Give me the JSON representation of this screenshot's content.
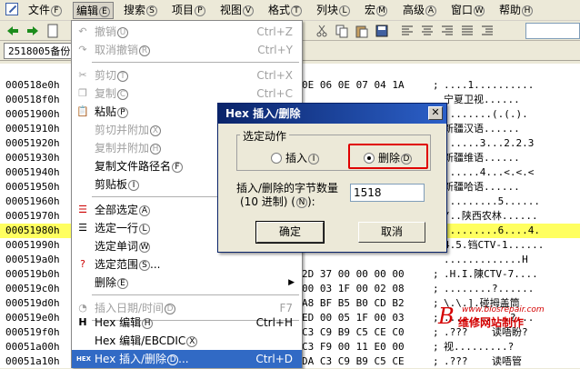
{
  "menubar": {
    "items": [
      {
        "label": "文件",
        "key": "F"
      },
      {
        "label": "编辑",
        "key": "E"
      },
      {
        "label": "搜索",
        "key": "S"
      },
      {
        "label": "项目",
        "key": "P"
      },
      {
        "label": "视图",
        "key": "V"
      },
      {
        "label": "格式",
        "key": "T"
      },
      {
        "label": "列块",
        "key": "L"
      },
      {
        "label": "宏",
        "key": "M"
      },
      {
        "label": "高级",
        "key": "A"
      },
      {
        "label": "窗口",
        "key": "W"
      },
      {
        "label": "帮助",
        "key": "H"
      }
    ]
  },
  "tab": {
    "label": "2518005备份"
  },
  "dropdown": {
    "items": [
      {
        "label": "撤销",
        "key": "U",
        "shortcut": "Ctrl+Z",
        "disabled": true,
        "icon": "undo-icon"
      },
      {
        "label": "取消撤销",
        "key": "R",
        "shortcut": "Ctrl+Y",
        "disabled": true,
        "icon": "redo-icon"
      },
      {
        "label": "剪切",
        "key": "T",
        "shortcut": "Ctrl+X",
        "disabled": true,
        "icon": "cut-icon"
      },
      {
        "label": "复制",
        "key": "C",
        "shortcut": "Ctrl+C",
        "disabled": true,
        "icon": "copy-icon"
      },
      {
        "label": "粘贴",
        "key": "P",
        "shortcut": "",
        "disabled": false,
        "icon": "paste-icon"
      },
      {
        "label": "剪切并附加",
        "key": "X",
        "shortcut": "",
        "disabled": true,
        "icon": ""
      },
      {
        "label": "复制并附加",
        "key": "H",
        "shortcut": "",
        "disabled": true,
        "icon": ""
      },
      {
        "label": "复制文件路径名",
        "key": "F",
        "shortcut": "",
        "disabled": false,
        "icon": ""
      },
      {
        "label": "剪贴板",
        "key": "I",
        "shortcut": "",
        "disabled": false,
        "icon": "",
        "submenu": true
      },
      {
        "label": "全部选定",
        "key": "A",
        "shortcut": "",
        "disabled": false,
        "icon": "select-all-icon"
      },
      {
        "label": "选定一行",
        "key": "L",
        "shortcut": "",
        "disabled": false,
        "icon": "select-line-icon"
      },
      {
        "label": "选定单词",
        "key": "W",
        "shortcut": "",
        "disabled": false,
        "icon": ""
      },
      {
        "label": "选定范围",
        "key": "S",
        "shortcut": "",
        "disabled": false,
        "icon": "select-range-icon",
        "suffix": "..."
      },
      {
        "label": "删除",
        "key": "E",
        "shortcut": "",
        "disabled": false,
        "icon": "",
        "submenu": true
      },
      {
        "label": "插入日期/时间",
        "key": "D",
        "shortcut": "F7",
        "disabled": true,
        "icon": "clock-icon"
      },
      {
        "label": "Hex 编辑",
        "key": "H",
        "shortcut": "Ctrl+H",
        "disabled": false,
        "icon": "hex-icon"
      },
      {
        "label": "Hex 编辑/EBCDIC",
        "key": "X",
        "shortcut": "",
        "disabled": false,
        "icon": ""
      },
      {
        "label": "Hex 插入/删除",
        "key": "D",
        "shortcut": "Ctrl+D",
        "disabled": false,
        "icon": "hex-insert-icon",
        "suffix": "...",
        "selected": true
      }
    ]
  },
  "hex_rows": [
    {
      "addr": "000518e0h",
      "hex": "0E 06 0E 07 04 1A",
      "ascii": "....1.........."
    },
    {
      "addr": "000518f0h",
      "hex": "",
      "ascii": "宁夏卫视......"
    },
    {
      "addr": "00051900h",
      "hex": "",
      "ascii": "........(.(.)."
    },
    {
      "addr": "00051910h",
      "hex": "",
      "ascii": "新疆汉语......"
    },
    {
      "addr": "00051920h",
      "hex": "",
      "ascii": "......3...2.2.3"
    },
    {
      "addr": "00051930h",
      "hex": "",
      "ascii": "新疆维语......"
    },
    {
      "addr": "00051940h",
      "hex": "",
      "ascii": "......4...<.<.<"
    },
    {
      "addr": "00051950h",
      "hex": "",
      "ascii": "新疆哈语......"
    },
    {
      "addr": "00051960h",
      "hex": "",
      "ascii": ".........5......"
    },
    {
      "addr": "00051970h",
      "hex": "",
      "ascii": "/..陕西农林......"
    },
    {
      "addr": "00051980h",
      "hex": "",
      "ascii": ".........6....4."
    },
    {
      "addr": "00051990h",
      "hex": "",
      "ascii": "4.5.铛CTV-1......"
    },
    {
      "addr": "000519a0h",
      "hex": "",
      "ascii": ".............H"
    },
    {
      "addr": "000519b0h",
      "hex": "2D 37 00 00 00 00",
      "ascii": ".H.I.陳CTV-7...."
    },
    {
      "addr": "000519c0h",
      "hex": "00 03 1F 00 02 08",
      "ascii": "........?......"
    },
    {
      "addr": "000519d0h",
      "hex": "A8 BF B5 B0 CD B2",
      "ascii": "\\.\\.].碰拇盖筒"
    },
    {
      "addr": "000519e0h",
      "hex": "ED 00 05 1F 00 03",
      "ascii": "...........?..."
    },
    {
      "addr": "000519f0h",
      "hex": "C3 C9 B9 C5 CE C0",
      "ascii": ".???    读唔盼?"
    },
    {
      "addr": "00051a00h",
      "hex": "C3 F9 00 11 E0 00",
      "ascii": "视.........?"
    },
    {
      "addr": "00051a10h",
      "hex": "DA C3 C9 B9 C5 CE",
      "ascii": ".???    读唔管"
    }
  ],
  "dialog": {
    "title": "Hex 插入/删除",
    "group_label": "选定动作",
    "insert_label": "插入",
    "insert_key": "I",
    "delete_label": "删除",
    "delete_key": "D",
    "count_label_1": "插入/删除的字节数量",
    "count_label_2": "(10 进制)",
    "count_key": "N",
    "count_value": "1518",
    "ok_label": "确定",
    "cancel_label": "取消"
  },
  "watermark": {
    "url": "www.biosrepair.com",
    "letter": "B",
    "text": "维修网站制作"
  }
}
